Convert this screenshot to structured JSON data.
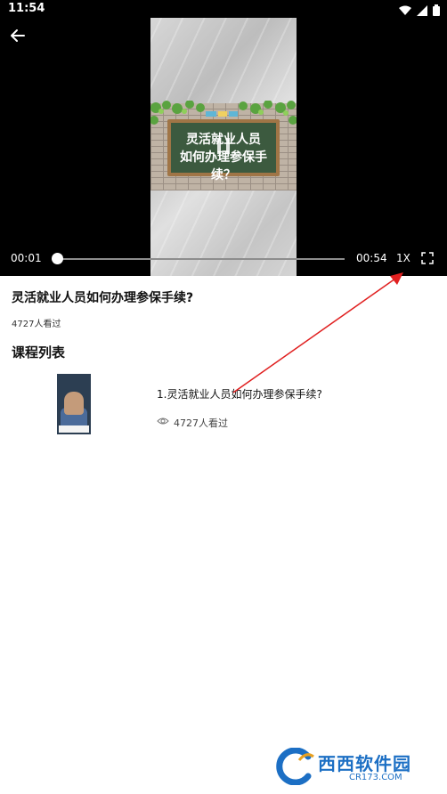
{
  "status_bar": {
    "time": "11:54"
  },
  "player": {
    "board_line1": "灵活就业人员",
    "board_line2": "如何办理参保手续？",
    "current_time": "00:01",
    "duration": "00:54",
    "speed": "1X",
    "progress": 0.02
  },
  "video": {
    "title": "灵活就业人员如何办理参保手续?",
    "views": "4727人看过"
  },
  "course_list": {
    "heading": "课程列表",
    "items": [
      {
        "title": "1.灵活就业人员如何办理参保手续?",
        "views": "4727人看过"
      }
    ]
  },
  "watermark": {
    "main": "西西软件园",
    "sub": "CR173.COM"
  },
  "colors": {
    "annotation_arrow": "#e02020",
    "brand": "#1c6fc4"
  },
  "icons": [
    "back-arrow-icon",
    "wifi-icon",
    "signal-icon",
    "battery-icon",
    "pause-icon",
    "fullscreen-icon",
    "eye-icon"
  ]
}
